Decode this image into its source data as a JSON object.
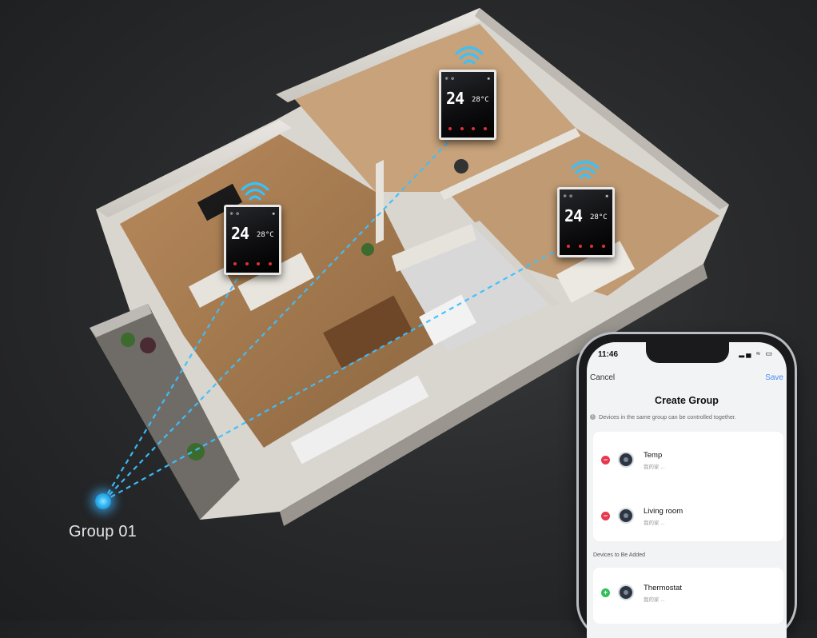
{
  "group_label": "Group 01",
  "thermostat_display": {
    "temperature": "24",
    "unit": "°",
    "secondary": "28°C"
  },
  "phone": {
    "status_time": "11:46",
    "status_icons": "▂▄ ≈ ▭",
    "nav": {
      "cancel": "Cancel",
      "title": "Create Group",
      "save": "Save"
    },
    "hint": "Devices in the same group can be controlled together.",
    "group_devices": [
      {
        "name": "Temp",
        "location": "我的家 ..."
      },
      {
        "name": "Living room",
        "location": "我的家 ..."
      }
    ],
    "add_section_title": "Devices to Be Added",
    "add_devices": [
      {
        "name": "Thermostat",
        "location": "我的家 ..."
      }
    ]
  },
  "colors": {
    "accent_blue": "#2fb3f0",
    "wifi": "#34c3ff",
    "remove": "#e8384f",
    "add": "#2fbf57",
    "save_link": "#4a8ef0"
  }
}
